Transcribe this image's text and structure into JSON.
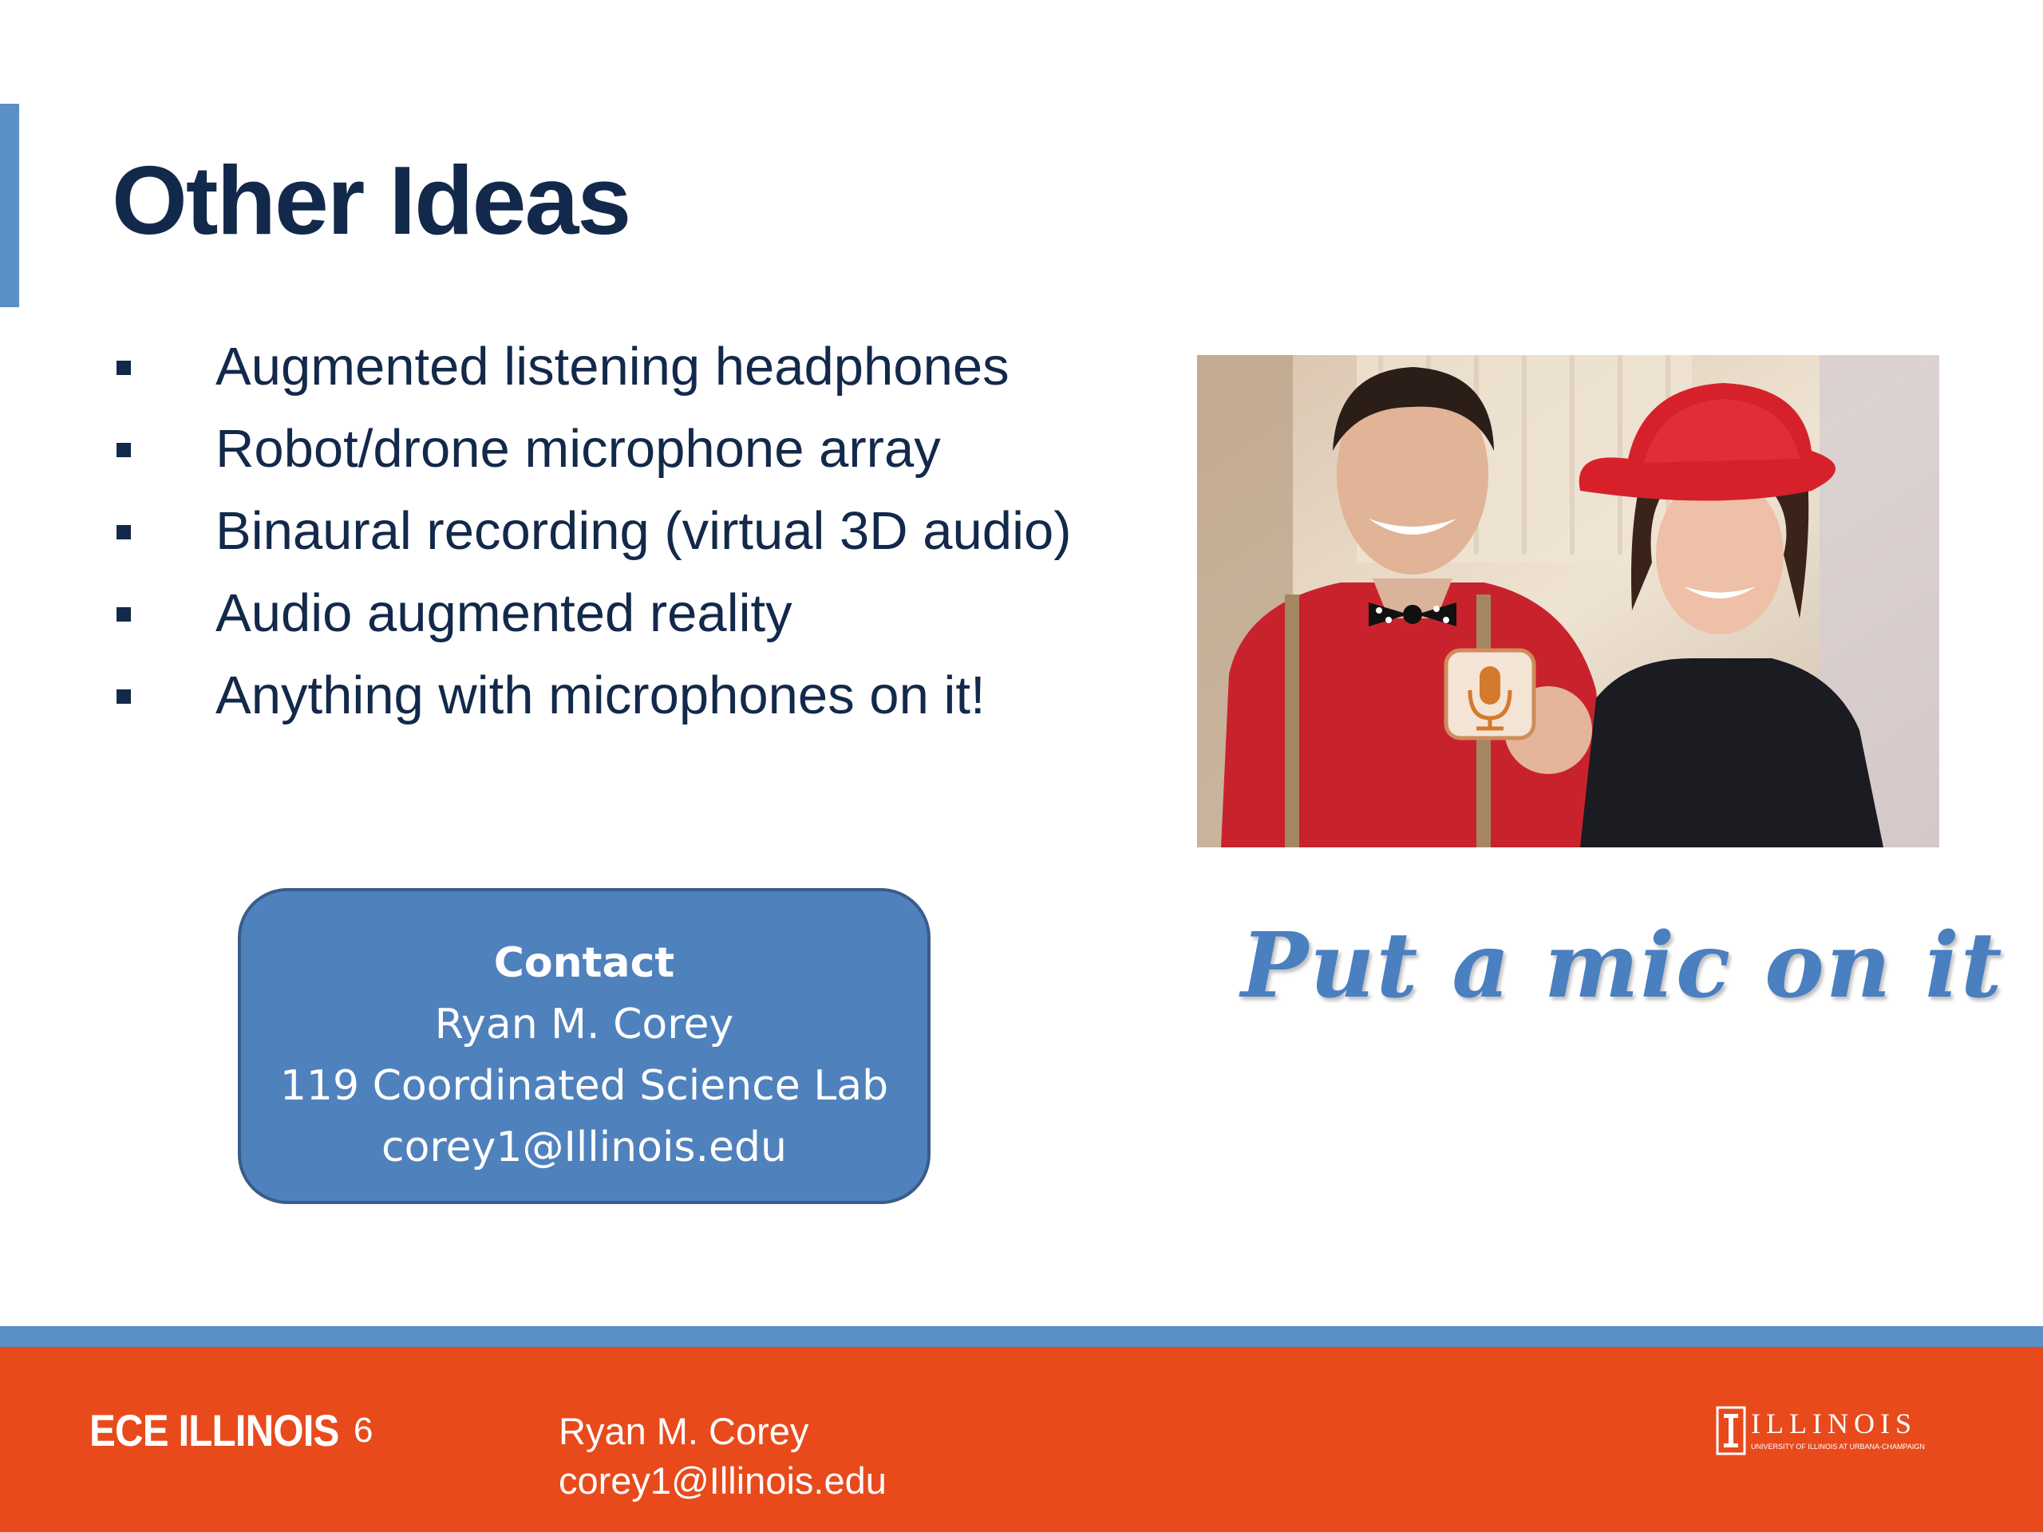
{
  "slide": {
    "title": "Other Ideas",
    "bullets": [
      "Augmented listening headphones",
      "Robot/drone microphone array",
      "Binaural recording (virtual 3D audio)",
      "Audio augmented reality",
      "Anything with microphones on it!"
    ],
    "tagline": "Put a mic on it",
    "contact": {
      "heading": "Contact",
      "name": "Ryan M. Corey",
      "office": "119 Coordinated Science Lab",
      "email": "corey1@Illinois.edu"
    }
  },
  "footer": {
    "logo_text": "ECE ILLINOIS",
    "page_number": "6",
    "author": "Ryan M. Corey",
    "email": "corey1@Illinois.edu",
    "university_logo": "ILLINOIS",
    "university_subtitle": "UNIVERSITY OF ILLINOIS AT URBANA-CHAMPAIGN"
  },
  "icons": {
    "photo": "photo-two-people-holding-microphone-app-icon",
    "mic": "microphone-icon"
  },
  "colors": {
    "title": "#13294b",
    "accent_blue": "#5b8fc7",
    "contact_box": "#4f81bd",
    "footer_orange": "#e84a1c",
    "tagline": "#4a7fc0"
  }
}
